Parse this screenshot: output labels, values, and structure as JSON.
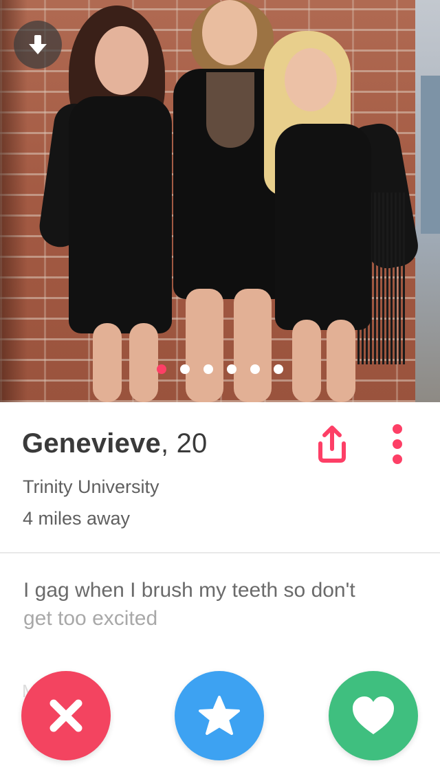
{
  "photo": {
    "total_photos": 6,
    "active_index": 0,
    "download_icon": "arrow-down-icon"
  },
  "profile": {
    "name": "Genevieve",
    "age_text": ", 20",
    "school": "Trinity University",
    "distance": "4 miles away",
    "share_icon": "share-icon",
    "more_icon": "more-vertical-icon"
  },
  "bio": {
    "line1": "I gag when I brush my teeth so don't",
    "line2": "get too excited"
  },
  "faded_label": "M         em",
  "actions": {
    "nope_icon": "close-icon",
    "super_like_icon": "star-icon",
    "like_icon": "heart-icon"
  },
  "colors": {
    "brand_pink": "#fd3f66",
    "nope": "#f34460",
    "super_like": "#3da2f2",
    "like": "#3fbf7f",
    "text_dark": "#3a3a3a",
    "text_muted": "#5f5f5f"
  }
}
